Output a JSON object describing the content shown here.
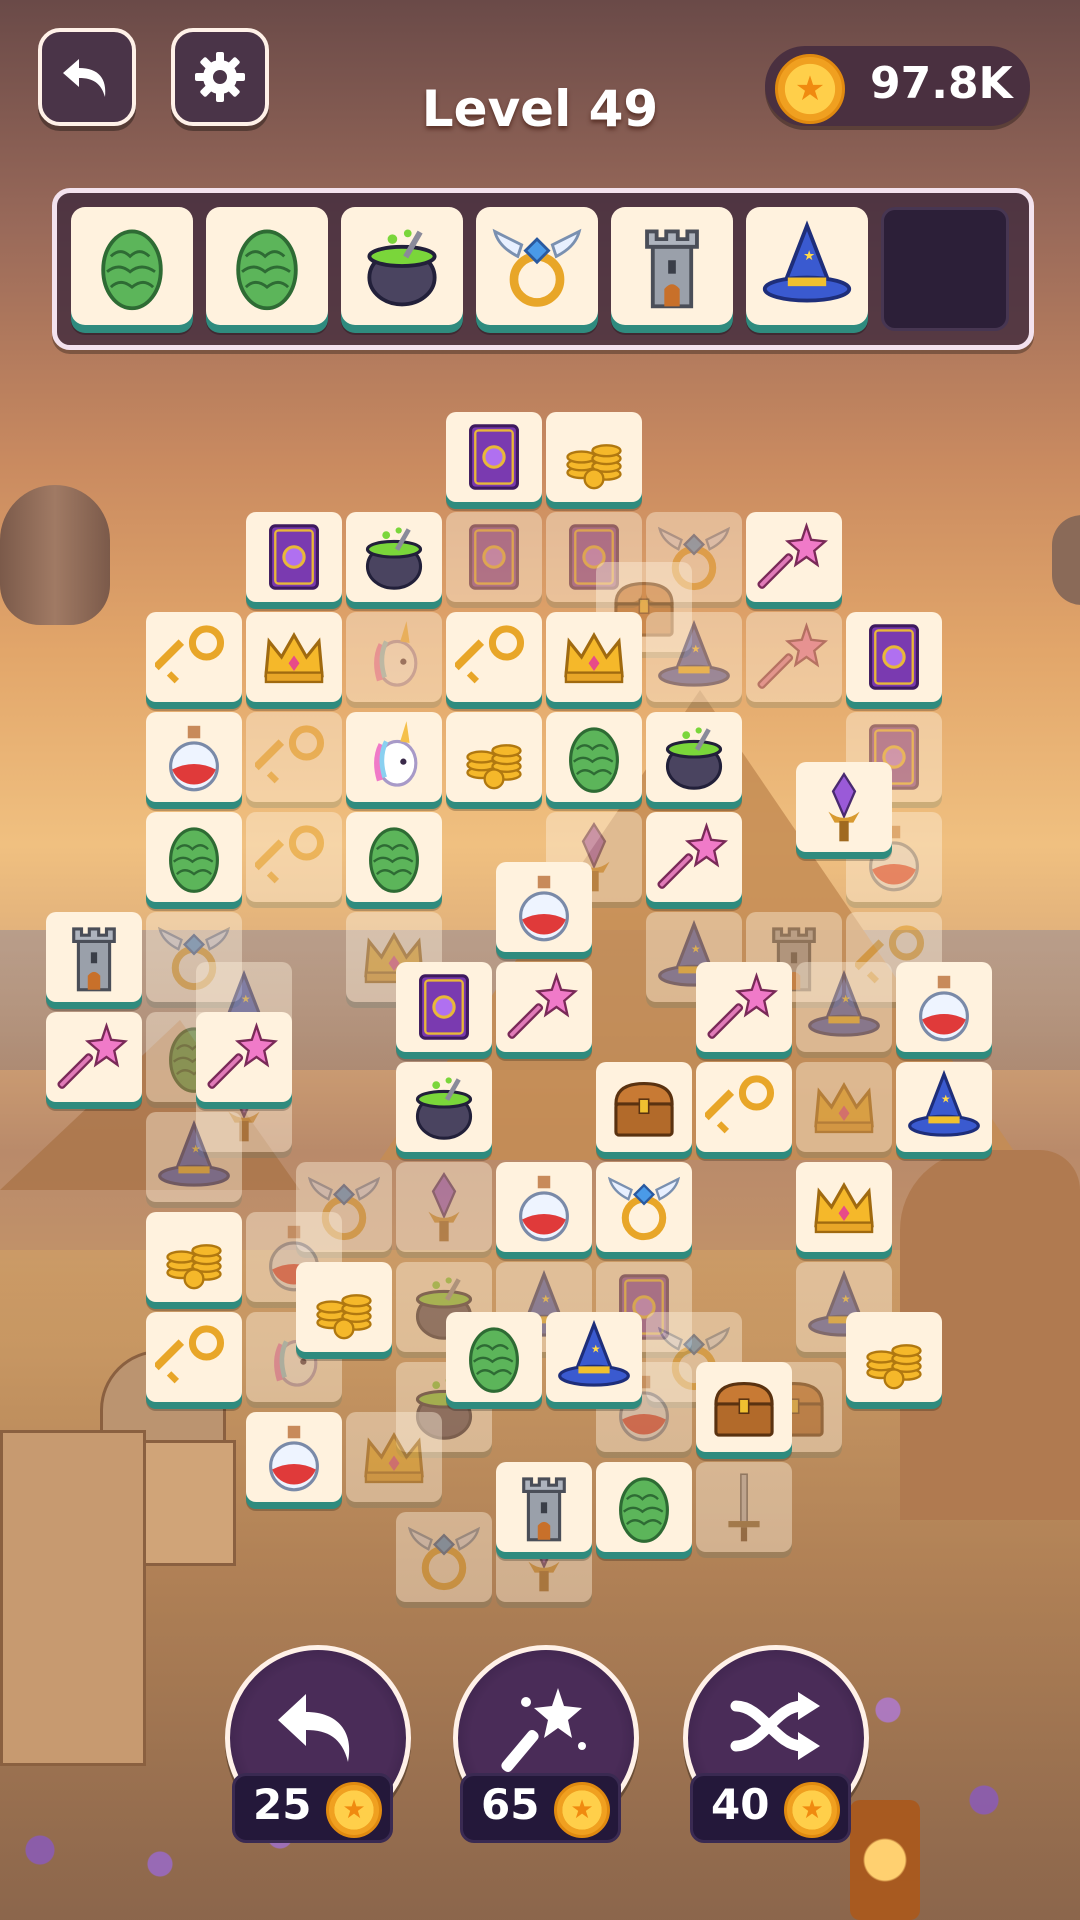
{
  "header": {
    "level_label": "Level 49",
    "coin_balance": "97.8K"
  },
  "icons": {
    "back": "undo-arrow-icon",
    "settings": "gear-icon",
    "coin": "coin-icon"
  },
  "tray": {
    "capacity": 7,
    "slots": [
      "dragon-egg",
      "dragon-egg",
      "cauldron",
      "winged-ring",
      "tower",
      "wizard-hat",
      null
    ]
  },
  "board": {
    "top_tiles": [
      {
        "icon": "spellbook",
        "col": 0,
        "row": 0
      },
      {
        "icon": "gold-coins",
        "col": 1,
        "row": 0
      },
      {
        "icon": "spellbook",
        "col": -2,
        "row": 1
      },
      {
        "icon": "cauldron",
        "col": -1,
        "row": 1
      },
      {
        "icon": "magic-wand",
        "col": 3,
        "row": 1
      },
      {
        "icon": "golden-key",
        "col": -3,
        "row": 2
      },
      {
        "icon": "crown",
        "col": -2,
        "row": 2
      },
      {
        "icon": "golden-key",
        "col": 0,
        "row": 2
      },
      {
        "icon": "crown",
        "col": 1,
        "row": 2
      },
      {
        "icon": "spellbook",
        "col": 4,
        "row": 2
      },
      {
        "icon": "potion",
        "col": -3,
        "row": 3
      },
      {
        "icon": "unicorn",
        "col": -1,
        "row": 3
      },
      {
        "icon": "gold-coins",
        "col": 0,
        "row": 3
      },
      {
        "icon": "dragon-egg",
        "col": 1,
        "row": 3
      },
      {
        "icon": "cauldron",
        "col": 2,
        "row": 3
      },
      {
        "icon": "crystal",
        "col": 3.5,
        "row": 3.5
      },
      {
        "icon": "dragon-egg",
        "col": -3,
        "row": 4
      },
      {
        "icon": "dragon-egg",
        "col": -1,
        "row": 4
      },
      {
        "icon": "magic-wand",
        "col": 2,
        "row": 4
      },
      {
        "icon": "potion",
        "col": 0.5,
        "row": 4.5
      },
      {
        "icon": "tower",
        "col": -4,
        "row": 5
      },
      {
        "icon": "spellbook",
        "col": -0.5,
        "row": 5.5
      },
      {
        "icon": "magic-wand",
        "col": 0.5,
        "row": 5.5
      },
      {
        "icon": "magic-wand",
        "col": 2.5,
        "row": 5.5
      },
      {
        "icon": "potion",
        "col": 4.5,
        "row": 5.5
      },
      {
        "icon": "magic-wand",
        "col": -4,
        "row": 6
      },
      {
        "icon": "magic-wand",
        "col": -2.5,
        "row": 6
      },
      {
        "icon": "cauldron",
        "col": -0.5,
        "row": 6.5
      },
      {
        "icon": "treasure-chest",
        "col": 1.5,
        "row": 6.5
      },
      {
        "icon": "golden-key",
        "col": 2.5,
        "row": 6.5
      },
      {
        "icon": "wizard-hat",
        "col": 4.5,
        "row": 6.5
      },
      {
        "icon": "potion",
        "col": 0.5,
        "row": 7.5
      },
      {
        "icon": "winged-ring",
        "col": 1.5,
        "row": 7.5
      },
      {
        "icon": "crown",
        "col": 3.5,
        "row": 7.5
      },
      {
        "icon": "gold-coins",
        "col": -3,
        "row": 8
      },
      {
        "icon": "gold-coins",
        "col": -1.5,
        "row": 8.5
      },
      {
        "icon": "golden-key",
        "col": -3,
        "row": 9
      },
      {
        "icon": "dragon-egg",
        "col": 0,
        "row": 9
      },
      {
        "icon": "wizard-hat",
        "col": 1,
        "row": 9
      },
      {
        "icon": "gold-coins",
        "col": 4,
        "row": 9
      },
      {
        "icon": "treasure-chest",
        "col": 2.5,
        "row": 9.5
      },
      {
        "icon": "potion",
        "col": -2,
        "row": 10
      },
      {
        "icon": "tower",
        "col": 0.5,
        "row": 10.5
      },
      {
        "icon": "dragon-egg",
        "col": 1.5,
        "row": 10.5
      }
    ],
    "covered_tiles": [
      {
        "icon": "spellbook",
        "col": 0,
        "row": 1
      },
      {
        "icon": "spellbook",
        "col": 1,
        "row": 1
      },
      {
        "icon": "winged-ring",
        "col": 2,
        "row": 1
      },
      {
        "icon": "treasure-chest",
        "col": 1.5,
        "row": 1.5
      },
      {
        "icon": "unicorn",
        "col": -1,
        "row": 2
      },
      {
        "icon": "wizard-hat",
        "col": 2,
        "row": 2
      },
      {
        "icon": "magic-wand",
        "col": 3,
        "row": 2
      },
      {
        "icon": "golden-key",
        "col": -2,
        "row": 3
      },
      {
        "icon": "spellbook",
        "col": 4,
        "row": 3
      },
      {
        "icon": "golden-key",
        "col": -2,
        "row": 4
      },
      {
        "icon": "crystal",
        "col": 1,
        "row": 4
      },
      {
        "icon": "potion",
        "col": 4,
        "row": 4
      },
      {
        "icon": "winged-ring",
        "col": -3,
        "row": 5
      },
      {
        "icon": "crown",
        "col": -1,
        "row": 5
      },
      {
        "icon": "wizard-hat",
        "col": 2,
        "row": 5
      },
      {
        "icon": "tower",
        "col": 3,
        "row": 5
      },
      {
        "icon": "golden-key",
        "col": 4,
        "row": 5
      },
      {
        "icon": "wizard-hat",
        "col": -2.5,
        "row": 5.5
      },
      {
        "icon": "dragon-egg",
        "col": -3,
        "row": 6
      },
      {
        "icon": "wizard-hat",
        "col": 3.5,
        "row": 5.5
      },
      {
        "icon": "crystal",
        "col": -2.5,
        "row": 6.5
      },
      {
        "icon": "crown",
        "col": 3.5,
        "row": 6.5
      },
      {
        "icon": "wizard-hat",
        "col": -3,
        "row": 7
      },
      {
        "icon": "winged-ring",
        "col": -1.5,
        "row": 7.5
      },
      {
        "icon": "crystal",
        "col": -0.5,
        "row": 7.5
      },
      {
        "icon": "potion",
        "col": -2,
        "row": 8
      },
      {
        "icon": "cauldron",
        "col": -0.5,
        "row": 8.5
      },
      {
        "icon": "wizard-hat",
        "col": 0.5,
        "row": 8.5
      },
      {
        "icon": "spellbook",
        "col": 1.5,
        "row": 8.5
      },
      {
        "icon": "wizard-hat",
        "col": 3.5,
        "row": 8.5
      },
      {
        "icon": "unicorn",
        "col": -2,
        "row": 9
      },
      {
        "icon": "winged-ring",
        "col": 2,
        "row": 9
      },
      {
        "icon": "treasure-chest",
        "col": 3,
        "row": 9.5
      },
      {
        "icon": "cauldron",
        "col": -0.5,
        "row": 9.5
      },
      {
        "icon": "potion",
        "col": 1.5,
        "row": 9.5
      },
      {
        "icon": "crown",
        "col": -1,
        "row": 10
      },
      {
        "icon": "sword",
        "col": 2.5,
        "row": 10.5
      },
      {
        "icon": "winged-ring",
        "col": -0.5,
        "row": 11
      },
      {
        "icon": "crystal",
        "col": 0.5,
        "row": 11
      }
    ]
  },
  "boosters": [
    {
      "name": "undo-booster",
      "icon": "undo-arrow-icon",
      "price": "25"
    },
    {
      "name": "magic-wand-booster",
      "icon": "magic-wand-icon",
      "price": "65"
    },
    {
      "name": "shuffle-booster",
      "icon": "shuffle-icon",
      "price": "40"
    }
  ],
  "colors": {
    "tile_face": "#fff2de",
    "tile_edge": "#2f8b7e",
    "panel": "#4a3448",
    "coin": "#ffc83a"
  }
}
